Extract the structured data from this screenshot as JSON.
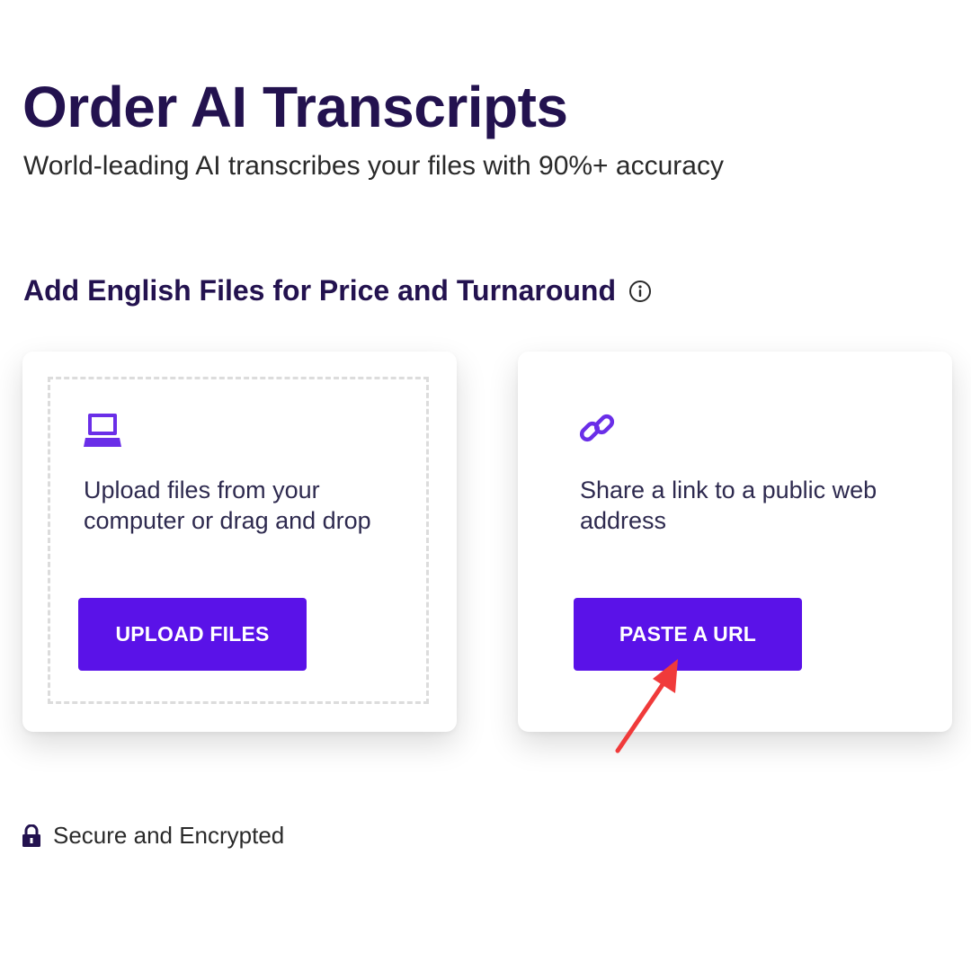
{
  "header": {
    "title": "Order AI Transcripts",
    "subtitle": "World-leading AI transcribes your files with 90%+ accuracy"
  },
  "section": {
    "heading": "Add English Files for Price and Turnaround",
    "info_icon": "info-circle-icon"
  },
  "upload_card": {
    "icon": "laptop-icon",
    "description": "Upload files from your computer or drag and drop",
    "button_label": "UPLOAD FILES"
  },
  "url_card": {
    "icon": "link-icon",
    "description": "Share a link to a public web address",
    "button_label": "PASTE A URL"
  },
  "annotation": {
    "icon": "red-arrow-icon",
    "color": "#f03a3a"
  },
  "footer": {
    "icon": "lock-icon",
    "secure_label": "Secure and Encrypted"
  },
  "colors": {
    "brand_dark": "#23124f",
    "accent": "#5a12e8",
    "icon_purple": "#6a2ee8"
  }
}
